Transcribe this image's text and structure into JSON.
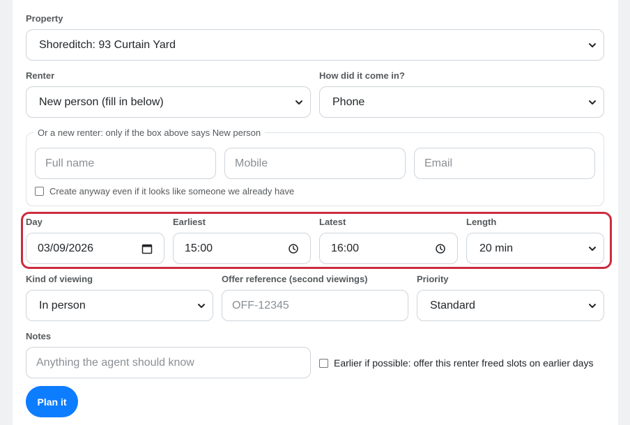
{
  "property": {
    "label": "Property",
    "value": "Shoreditch: 93 Curtain Yard"
  },
  "renter": {
    "label": "Renter",
    "value": "New person (fill in below)"
  },
  "source": {
    "label": "How did it come in?",
    "value": "Phone"
  },
  "new_renter": {
    "legend": "Or a new renter: only if the box above says New person",
    "full_name_placeholder": "Full name",
    "mobile_placeholder": "Mobile",
    "email_placeholder": "Email",
    "create_anyway_label": "Create anyway even if it looks like someone we already have",
    "create_anyway_checked": false
  },
  "schedule": {
    "day_label": "Day",
    "day_value": "03/09/2026",
    "earliest_label": "Earliest",
    "earliest_value": "15:00",
    "latest_label": "Latest",
    "latest_value": "16:00",
    "length_label": "Length",
    "length_value": "20 min"
  },
  "viewing": {
    "kind_label": "Kind of viewing",
    "kind_value": "In person",
    "offer_label": "Offer reference (second viewings)",
    "offer_placeholder": "OFF-12345",
    "priority_label": "Priority",
    "priority_value": "Standard"
  },
  "notes": {
    "label": "Notes",
    "placeholder": "Anything the agent should know",
    "earlier_label": "Earlier if possible: offer this renter freed slots on earlier days",
    "earlier_checked": false
  },
  "submit": {
    "label": "Plan it"
  },
  "colors": {
    "accent": "#0d7dff",
    "highlight": "#cc2b3f",
    "border": "#ced4da"
  },
  "icons": {
    "select": "chevron-down-icon",
    "date": "calendar-icon",
    "time": "clock-icon"
  }
}
